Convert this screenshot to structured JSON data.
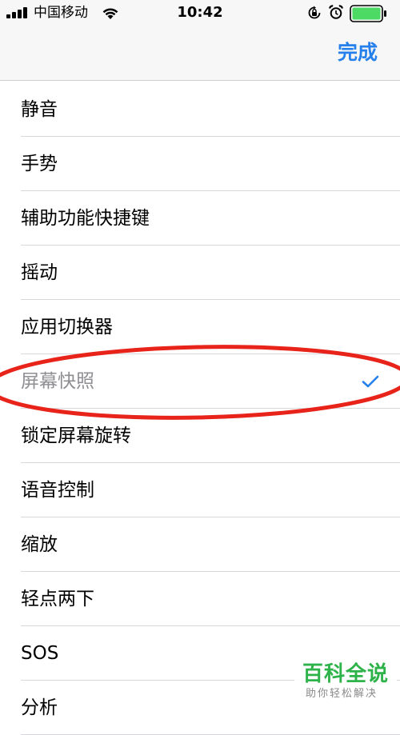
{
  "status_bar": {
    "carrier": "中国移动",
    "time": "10:42",
    "battery_color": "#4cd964"
  },
  "nav": {
    "done_label": "完成",
    "accent_color": "#2680eb"
  },
  "list": {
    "items": [
      {
        "label": "静音",
        "selected": false
      },
      {
        "label": "手势",
        "selected": false
      },
      {
        "label": "辅助功能快捷键",
        "selected": false
      },
      {
        "label": "摇动",
        "selected": false
      },
      {
        "label": "应用切换器",
        "selected": false
      },
      {
        "label": "屏幕快照",
        "selected": true
      },
      {
        "label": "锁定屏幕旋转",
        "selected": false
      },
      {
        "label": "语音控制",
        "selected": false
      },
      {
        "label": "缩放",
        "selected": false
      },
      {
        "label": "轻点两下",
        "selected": false
      },
      {
        "label": "SOS",
        "selected": false
      },
      {
        "label": "分析",
        "selected": false
      }
    ]
  },
  "annotation": {
    "color": "#e8231a"
  },
  "watermark": {
    "title": "百科全说",
    "subtitle": "助你轻松解决"
  }
}
